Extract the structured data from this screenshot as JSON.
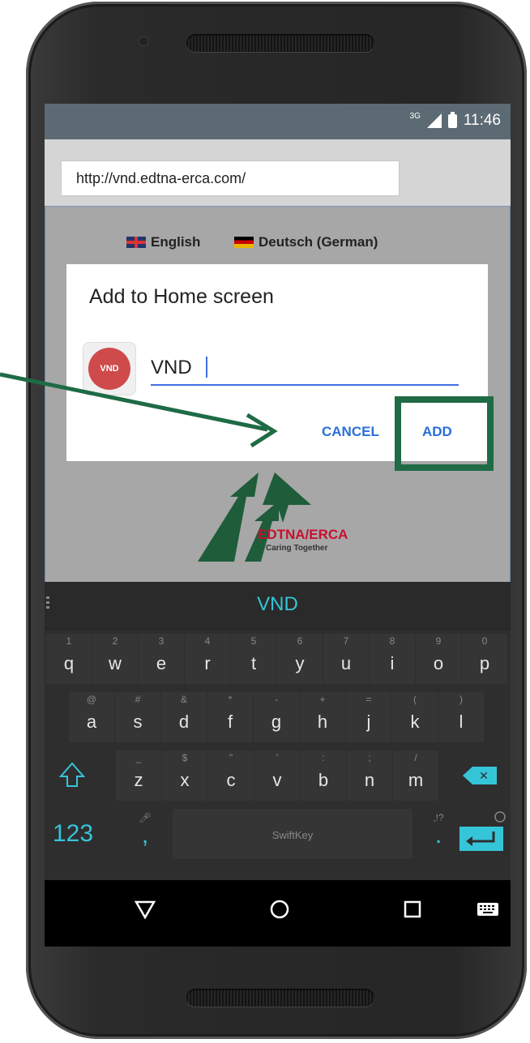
{
  "status_bar": {
    "network": "3G",
    "time": "11:46"
  },
  "browser": {
    "url": "http://vnd.edtna-erca.com/"
  },
  "page": {
    "languages": [
      {
        "label": "English",
        "flag": "uk-flag-icon"
      },
      {
        "label": "Deutsch (German)",
        "flag": "germany-flag-icon"
      }
    ],
    "logo": {
      "name": "EDTNA/ERCA",
      "tagline": "Caring Together",
      "color": "#1e5c3a",
      "red": "#c8102e"
    }
  },
  "dialog": {
    "title": "Add to Home screen",
    "icon_text": "VND",
    "name_value": "VND",
    "cancel_label": "CANCEL",
    "add_label": "ADD"
  },
  "keyboard": {
    "suggestion": "VND",
    "brand": "SwiftKey",
    "row1": [
      {
        "k": "q",
        "a": "1"
      },
      {
        "k": "w",
        "a": "2"
      },
      {
        "k": "e",
        "a": "3"
      },
      {
        "k": "r",
        "a": "4"
      },
      {
        "k": "t",
        "a": "5"
      },
      {
        "k": "y",
        "a": "6"
      },
      {
        "k": "u",
        "a": "7"
      },
      {
        "k": "i",
        "a": "8"
      },
      {
        "k": "o",
        "a": "9"
      },
      {
        "k": "p",
        "a": "0"
      }
    ],
    "row2": [
      {
        "k": "a",
        "a": "@"
      },
      {
        "k": "s",
        "a": "#"
      },
      {
        "k": "d",
        "a": "&"
      },
      {
        "k": "f",
        "a": "*"
      },
      {
        "k": "g",
        "a": "-"
      },
      {
        "k": "h",
        "a": "+"
      },
      {
        "k": "j",
        "a": "="
      },
      {
        "k": "k",
        "a": "("
      },
      {
        "k": "l",
        "a": ")"
      }
    ],
    "row3": [
      {
        "k": "z",
        "a": "_"
      },
      {
        "k": "x",
        "a": "$"
      },
      {
        "k": "c",
        "a": "\""
      },
      {
        "k": "v",
        "a": "'"
      },
      {
        "k": "b",
        "a": ":"
      },
      {
        "k": "n",
        "a": ";"
      },
      {
        "k": "m",
        "a": "/"
      }
    ],
    "numbers_label": "123",
    "comma": ",",
    "period": ".",
    "period_alt": ",!?"
  },
  "annotation": {
    "color": "#1e6b45"
  }
}
